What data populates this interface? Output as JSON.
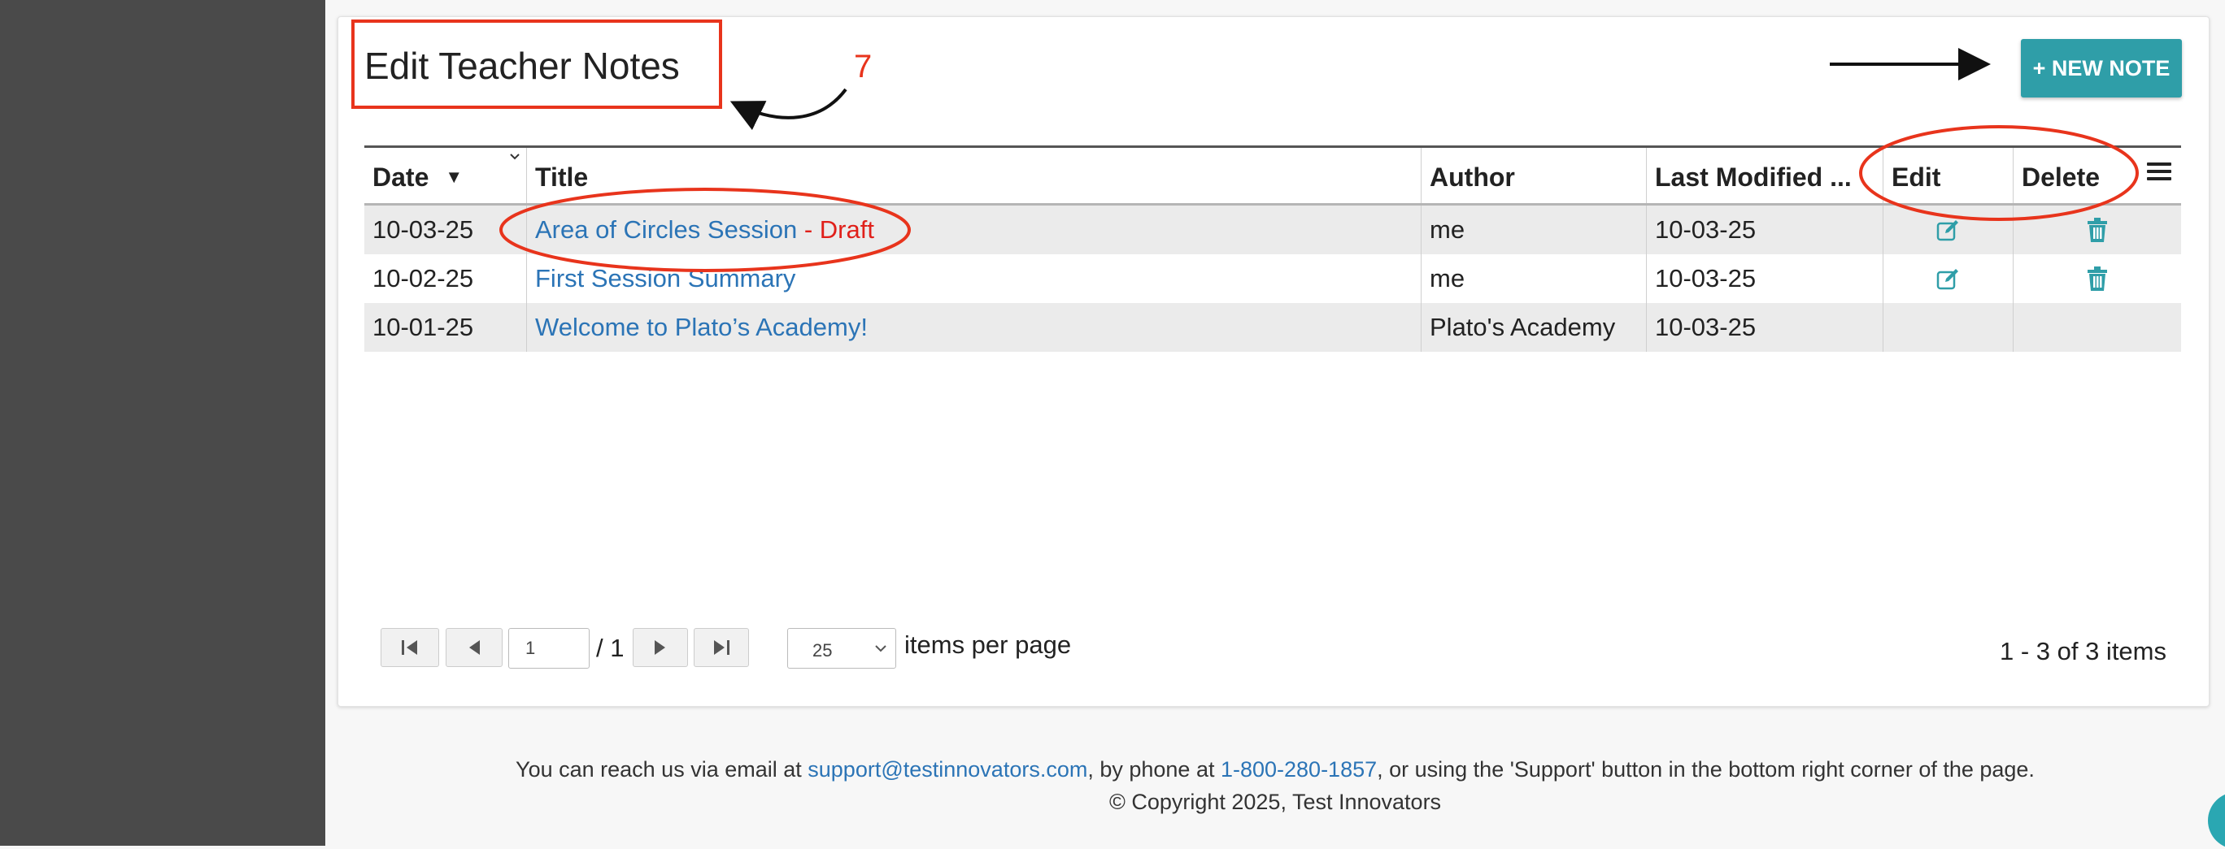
{
  "page": {
    "title": "Edit Teacher Notes",
    "new_note_label": "+ NEW NOTE"
  },
  "colors": {
    "accent": "#2f9ea8",
    "link": "#2b74b6",
    "draft": "#e0201a",
    "sidebar": "#4a4a4a",
    "annotation": "#e8341c"
  },
  "table": {
    "headers": {
      "date": "Date",
      "title": "Title",
      "author": "Author",
      "last_modified": "Last Modified ...",
      "edit": "Edit",
      "delete": "Delete"
    },
    "sort": {
      "column": "date",
      "direction": "descending"
    },
    "rows": [
      {
        "date": "10-03-25",
        "title": "Area of Circles Session",
        "draft_label": "- Draft",
        "author": "me",
        "last_modified": "10-03-25",
        "can_edit": true,
        "can_delete": true
      },
      {
        "date": "10-02-25",
        "title": "First Session Summary",
        "draft_label": "",
        "author": "me",
        "last_modified": "10-03-25",
        "can_edit": true,
        "can_delete": true
      },
      {
        "date": "10-01-25",
        "title": "Welcome to Plato’s Academy!",
        "draft_label": "",
        "author": "Plato's Academy",
        "last_modified": "10-03-25",
        "can_edit": false,
        "can_delete": false
      }
    ]
  },
  "icons": {
    "edit": "edit-icon",
    "delete": "trash-icon",
    "column_menu": "menu-icon",
    "first_page": "first-page-icon",
    "prev_page": "prev-page-icon",
    "next_page": "next-page-icon",
    "last_page": "last-page-icon"
  },
  "pager": {
    "current_page": "1",
    "total_pages": "/ 1",
    "page_size": "25",
    "page_size_label": "items per page",
    "summary": "1 - 3 of 3 items"
  },
  "footer": {
    "line1_prefix": "You can reach us via email at ",
    "email": "support@testinnovators.com",
    "line1_middle": ", by phone at ",
    "phone": "1-800-280-1857",
    "line1_suffix": ", or using the 'Support' button in the bottom right corner of the page.",
    "copyright": "© Copyright 2025, Test Innovators"
  },
  "annotation": {
    "step_number": "7"
  }
}
